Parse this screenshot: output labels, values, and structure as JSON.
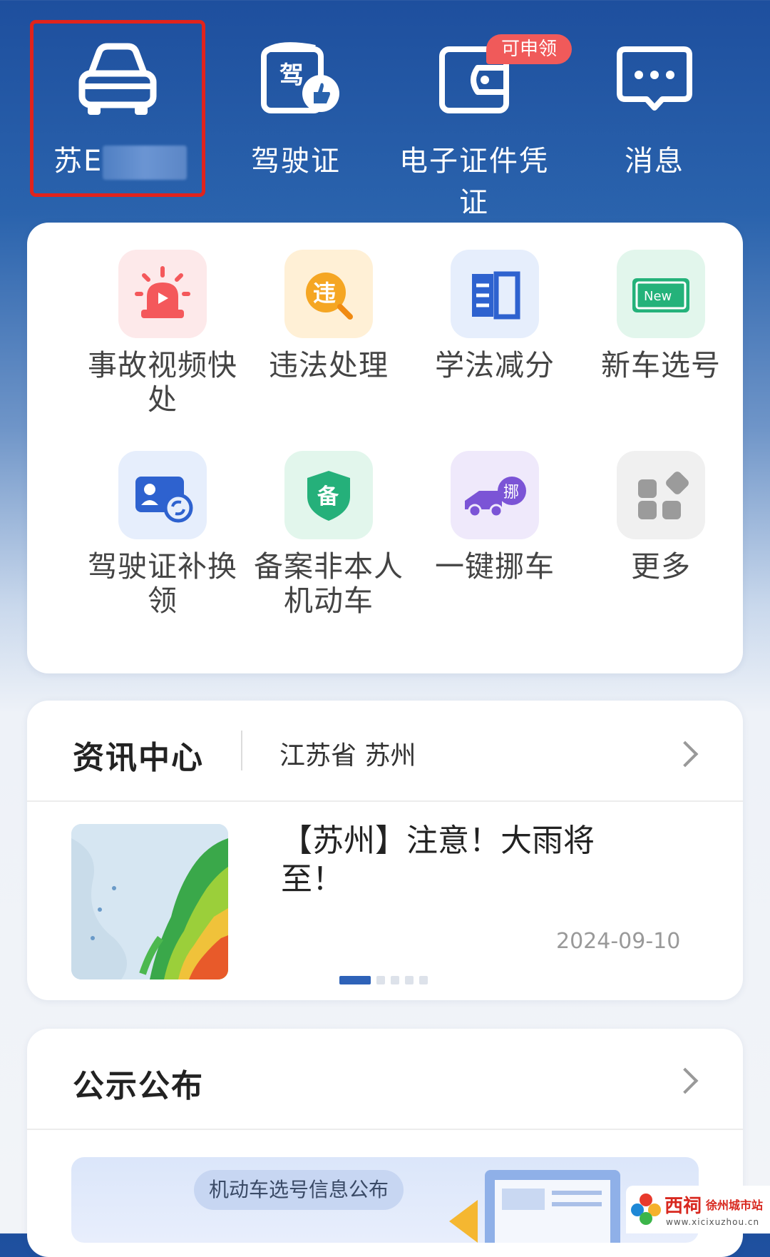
{
  "top_bar": {
    "vehicle_label": "苏E",
    "license_label": "驾驶证",
    "ecert_label": "电子证件凭证",
    "ecert_badge": "可申领",
    "messages_label": "消息"
  },
  "services": [
    {
      "name": "事故视频快处",
      "icon": "alarm-icon",
      "color": "#f4585b"
    },
    {
      "name": "违法处理",
      "icon": "violation-icon",
      "color": "#f39a1e"
    },
    {
      "name": "学法减分",
      "icon": "book-icon",
      "color": "#2e62cf"
    },
    {
      "name": "新车选号",
      "icon": "new-plate-icon",
      "color": "#24b27a"
    },
    {
      "name": "驾驶证补换领",
      "icon": "id-card-swap-icon",
      "color": "#2e62cf"
    },
    {
      "name": "备案非本人机动车",
      "icon": "shield-icon",
      "color": "#25b07a"
    },
    {
      "name": "一键挪车",
      "icon": "truck-icon",
      "color": "#7b54d6"
    },
    {
      "name": "更多",
      "icon": "grid-icon",
      "color": "#9b9b9b"
    }
  ],
  "icon_text": {
    "violation": "违",
    "new": "New",
    "shield": "备",
    "truck": "挪",
    "license_card": "驾"
  },
  "news": {
    "title": "资讯中心",
    "region": "江苏省 苏州",
    "headline": "【苏州】注意！大雨将至！",
    "date": "2024-09-10"
  },
  "notice": {
    "title": "公示公布",
    "banner_text": "机动车选号信息公布"
  },
  "watermark": {
    "brand": "西祠",
    "city": "徐州城市站",
    "url": "www.xicixuzhou.cn"
  }
}
